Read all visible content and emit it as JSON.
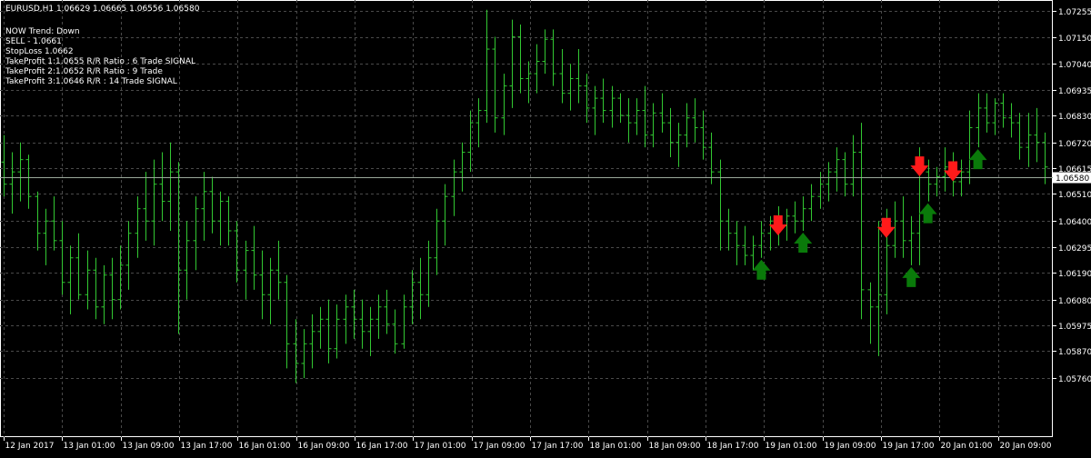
{
  "window": {
    "header": "EURUSD,H1  1.06629 1.06665 1.06556 1.06580"
  },
  "info_panel": {
    "lines": [
      "NOW Trend: Down",
      "SELL - 1.0661",
      "StopLoss 1.0662",
      "TakeProfit 1:1.0655 R/R Ratio : 6  Trade SIGNAL",
      "TakeProfit 2:1.0652 R/R Ratio : 9 Trade",
      "TakeProfit 3:1.0646 R/R : 14 Trade SIGNAL"
    ]
  },
  "colors": {
    "background": "#000000",
    "grid": "#4a4a4a",
    "bars": "#32c832",
    "axis": "#ffffff",
    "price_line": "#9aa89a",
    "buy_arrow": "#0a7a0a",
    "sell_arrow": "#ff1a1a"
  },
  "chart_data": {
    "type": "ohlc",
    "symbol": "EURUSD",
    "timeframe": "H1",
    "current_price": "1.06580",
    "ylim": [
      1.0552,
      1.073
    ],
    "grid": true,
    "y_ticks": [
      "1.07255",
      "1.07150",
      "1.07040",
      "1.06935",
      "1.06830",
      "1.06720",
      "1.06615",
      "1.06510",
      "1.06400",
      "1.06295",
      "1.06190",
      "1.06080",
      "1.05975",
      "1.05870",
      "1.05760"
    ],
    "x_ticks": [
      "12 Jan 2017",
      "13 Jan 01:00",
      "13 Jan 09:00",
      "13 Jan 17:00",
      "16 Jan 01:00",
      "16 Jan 09:00",
      "16 Jan 17:00",
      "17 Jan 01:00",
      "17 Jan 09:00",
      "17 Jan 17:00",
      "18 Jan 01:00",
      "18 Jan 09:00",
      "18 Jan 17:00",
      "19 Jan 01:00",
      "19 Jan 09:00",
      "19 Jan 17:00",
      "20 Jan 01:00",
      "20 Jan 09:00"
    ],
    "bars": [
      [
        1.0664,
        1.0675,
        1.065,
        1.0655
      ],
      [
        1.0655,
        1.0668,
        1.0643,
        1.066
      ],
      [
        1.066,
        1.0672,
        1.0648,
        1.0665
      ],
      [
        1.0665,
        1.0667,
        1.0645,
        1.065
      ],
      [
        1.065,
        1.0652,
        1.0628,
        1.0635
      ],
      [
        1.0635,
        1.0645,
        1.0622,
        1.064
      ],
      [
        1.064,
        1.065,
        1.0628,
        1.0632
      ],
      [
        1.0632,
        1.064,
        1.061,
        1.0615
      ],
      [
        1.0615,
        1.063,
        1.0602,
        1.0625
      ],
      [
        1.0625,
        1.0635,
        1.0608,
        1.061
      ],
      [
        1.061,
        1.0628,
        1.0604,
        1.062
      ],
      [
        1.062,
        1.0625,
        1.06,
        1.0605
      ],
      [
        1.0605,
        1.0622,
        1.0598,
        1.0618
      ],
      [
        1.0618,
        1.0625,
        1.06,
        1.0608
      ],
      [
        1.0608,
        1.063,
        1.0604,
        1.0622
      ],
      [
        1.0622,
        1.064,
        1.0612,
        1.0635
      ],
      [
        1.0635,
        1.065,
        1.0625,
        1.0645
      ],
      [
        1.0645,
        1.066,
        1.0632,
        1.064
      ],
      [
        1.064,
        1.0665,
        1.063,
        1.0655
      ],
      [
        1.0655,
        1.0668,
        1.064,
        1.0648
      ],
      [
        1.0648,
        1.0672,
        1.0636,
        1.066
      ],
      [
        1.066,
        1.0664,
        1.0594,
        1.062
      ],
      [
        1.062,
        1.064,
        1.0608,
        1.0632
      ],
      [
        1.0632,
        1.065,
        1.062,
        1.0645
      ],
      [
        1.0645,
        1.066,
        1.0632,
        1.0652
      ],
      [
        1.0652,
        1.0658,
        1.0635,
        1.064
      ],
      [
        1.064,
        1.0652,
        1.063,
        1.0648
      ],
      [
        1.0648,
        1.065,
        1.063,
        1.0636
      ],
      [
        1.0636,
        1.064,
        1.0615,
        1.062
      ],
      [
        1.062,
        1.0632,
        1.0608,
        1.0628
      ],
      [
        1.0628,
        1.0638,
        1.0612,
        1.0618
      ],
      [
        1.0618,
        1.0628,
        1.06,
        1.061
      ],
      [
        1.061,
        1.0625,
        1.0598,
        1.062
      ],
      [
        1.062,
        1.0632,
        1.0608,
        1.0615
      ],
      [
        1.0615,
        1.0618,
        1.058,
        1.059
      ],
      [
        1.059,
        1.06,
        1.0574,
        1.0582
      ],
      [
        1.0582,
        1.0596,
        1.0576,
        1.059
      ],
      [
        1.059,
        1.0602,
        1.058,
        1.0595
      ],
      [
        1.0595,
        1.0605,
        1.0588,
        1.06
      ],
      [
        1.06,
        1.0608,
        1.0582,
        1.0588
      ],
      [
        1.0588,
        1.0606,
        1.0584,
        1.06
      ],
      [
        1.06,
        1.061,
        1.059,
        1.0605
      ],
      [
        1.0605,
        1.0612,
        1.0592,
        1.06
      ],
      [
        1.06,
        1.0608,
        1.0588,
        1.0595
      ],
      [
        1.0595,
        1.0605,
        1.0585,
        1.06
      ],
      [
        1.06,
        1.061,
        1.0592,
        1.0605
      ],
      [
        1.0605,
        1.0612,
        1.0594,
        1.0598
      ],
      [
        1.0598,
        1.0604,
        1.0586,
        1.059
      ],
      [
        1.059,
        1.061,
        1.0588,
        1.0605
      ],
      [
        1.0605,
        1.062,
        1.0598,
        1.0615
      ],
      [
        1.0615,
        1.0625,
        1.06,
        1.061
      ],
      [
        1.061,
        1.0632,
        1.0605,
        1.0625
      ],
      [
        1.0625,
        1.0645,
        1.0618,
        1.064
      ],
      [
        1.064,
        1.0655,
        1.063,
        1.065
      ],
      [
        1.065,
        1.0665,
        1.0642,
        1.066
      ],
      [
        1.066,
        1.0672,
        1.0652,
        1.0668
      ],
      [
        1.0668,
        1.0685,
        1.066,
        1.068
      ],
      [
        1.068,
        1.069,
        1.067,
        1.0685
      ],
      [
        1.0685,
        1.0726,
        1.068,
        1.071
      ],
      [
        1.071,
        1.0715,
        1.0676,
        1.0682
      ],
      [
        1.0682,
        1.07,
        1.0675,
        1.0695
      ],
      [
        1.0695,
        1.0722,
        1.0686,
        1.0715
      ],
      [
        1.0715,
        1.072,
        1.0692,
        1.0698
      ],
      [
        1.0698,
        1.0705,
        1.0688,
        1.07
      ],
      [
        1.07,
        1.0712,
        1.0692,
        1.0705
      ],
      [
        1.0705,
        1.0718,
        1.07,
        1.0714
      ],
      [
        1.0714,
        1.0718,
        1.0695,
        1.07
      ],
      [
        1.07,
        1.071,
        1.0688,
        1.0692
      ],
      [
        1.0692,
        1.0704,
        1.0685,
        1.0698
      ],
      [
        1.0698,
        1.071,
        1.0688,
        1.0695
      ],
      [
        1.0695,
        1.07,
        1.068,
        1.0686
      ],
      [
        1.0686,
        1.0695,
        1.0675,
        1.069
      ],
      [
        1.069,
        1.0698,
        1.068,
        1.0685
      ],
      [
        1.0685,
        1.0695,
        1.0678,
        1.069
      ],
      [
        1.069,
        1.0692,
        1.068,
        1.0683
      ],
      [
        1.0683,
        1.069,
        1.0672,
        1.068
      ],
      [
        1.068,
        1.069,
        1.0675,
        1.0685
      ],
      [
        1.0685,
        1.0695,
        1.067,
        1.0675
      ],
      [
        1.0675,
        1.0688,
        1.067,
        1.0684
      ],
      [
        1.0684,
        1.0692,
        1.0676,
        1.068
      ],
      [
        1.068,
        1.0686,
        1.0666,
        1.0672
      ],
      [
        1.0672,
        1.068,
        1.0662,
        1.0675
      ],
      [
        1.0675,
        1.0688,
        1.067,
        1.0682
      ],
      [
        1.0682,
        1.069,
        1.0672,
        1.0678
      ],
      [
        1.0678,
        1.0685,
        1.0665,
        1.067
      ],
      [
        1.067,
        1.0676,
        1.0655,
        1.066
      ],
      [
        1.066,
        1.0665,
        1.0628,
        1.064
      ],
      [
        1.064,
        1.0645,
        1.0628,
        1.0635
      ],
      [
        1.0635,
        1.064,
        1.0622,
        1.063
      ],
      [
        1.063,
        1.0638,
        1.0622,
        1.0626
      ],
      [
        1.0626,
        1.0634,
        1.062,
        1.063
      ],
      [
        1.063,
        1.064,
        1.0625,
        1.0635
      ],
      [
        1.0635,
        1.0642,
        1.0628,
        1.064
      ],
      [
        1.064,
        1.0646,
        1.063,
        1.0638
      ],
      [
        1.0638,
        1.0645,
        1.0632,
        1.0642
      ],
      [
        1.0642,
        1.0648,
        1.0635,
        1.064
      ],
      [
        1.064,
        1.065,
        1.0636,
        1.0645
      ],
      [
        1.0645,
        1.0655,
        1.064,
        1.065
      ],
      [
        1.065,
        1.066,
        1.0645,
        1.0655
      ],
      [
        1.0655,
        1.0664,
        1.0648,
        1.066
      ],
      [
        1.066,
        1.067,
        1.0652,
        1.0665
      ],
      [
        1.0665,
        1.0668,
        1.065,
        1.0655
      ],
      [
        1.0655,
        1.0675,
        1.065,
        1.0668
      ],
      [
        1.0668,
        1.068,
        1.06,
        1.0612
      ],
      [
        1.0612,
        1.0615,
        1.059,
        1.0605
      ],
      [
        1.0605,
        1.064,
        1.0585,
        1.061
      ],
      [
        1.061,
        1.0645,
        1.0602,
        1.063
      ],
      [
        1.063,
        1.0648,
        1.0625,
        1.064
      ],
      [
        1.064,
        1.065,
        1.0625,
        1.0632
      ],
      [
        1.0632,
        1.0642,
        1.0622,
        1.0635
      ],
      [
        1.0635,
        1.067,
        1.0622,
        1.066
      ],
      [
        1.066,
        1.0665,
        1.0648,
        1.0655
      ],
      [
        1.0655,
        1.0662,
        1.065,
        1.0658
      ],
      [
        1.0658,
        1.067,
        1.0652,
        1.0662
      ],
      [
        1.0662,
        1.0668,
        1.065,
        1.0656
      ],
      [
        1.0656,
        1.0665,
        1.065,
        1.066
      ],
      [
        1.066,
        1.0685,
        1.0655,
        1.0678
      ],
      [
        1.0678,
        1.0692,
        1.067,
        1.0686
      ],
      [
        1.0686,
        1.0692,
        1.0676,
        1.068
      ],
      [
        1.068,
        1.069,
        1.0675,
        1.0688
      ],
      [
        1.0688,
        1.0692,
        1.0678,
        1.0682
      ],
      [
        1.0682,
        1.0688,
        1.0674,
        1.068
      ],
      [
        1.068,
        1.0684,
        1.0665,
        1.067
      ],
      [
        1.067,
        1.0684,
        1.0662,
        1.0675
      ],
      [
        1.0675,
        1.0686,
        1.0664,
        1.0672
      ],
      [
        1.0672,
        1.0676,
        1.0655,
        1.0662
      ]
    ],
    "signals": [
      {
        "type": "buy",
        "bar": 91
      },
      {
        "type": "sell",
        "bar": 93
      },
      {
        "type": "buy",
        "bar": 96
      },
      {
        "type": "sell",
        "bar": 106
      },
      {
        "type": "buy",
        "bar": 109
      },
      {
        "type": "sell",
        "bar": 110
      },
      {
        "type": "buy",
        "bar": 111
      },
      {
        "type": "sell",
        "bar": 114
      },
      {
        "type": "buy",
        "bar": 117
      }
    ]
  }
}
